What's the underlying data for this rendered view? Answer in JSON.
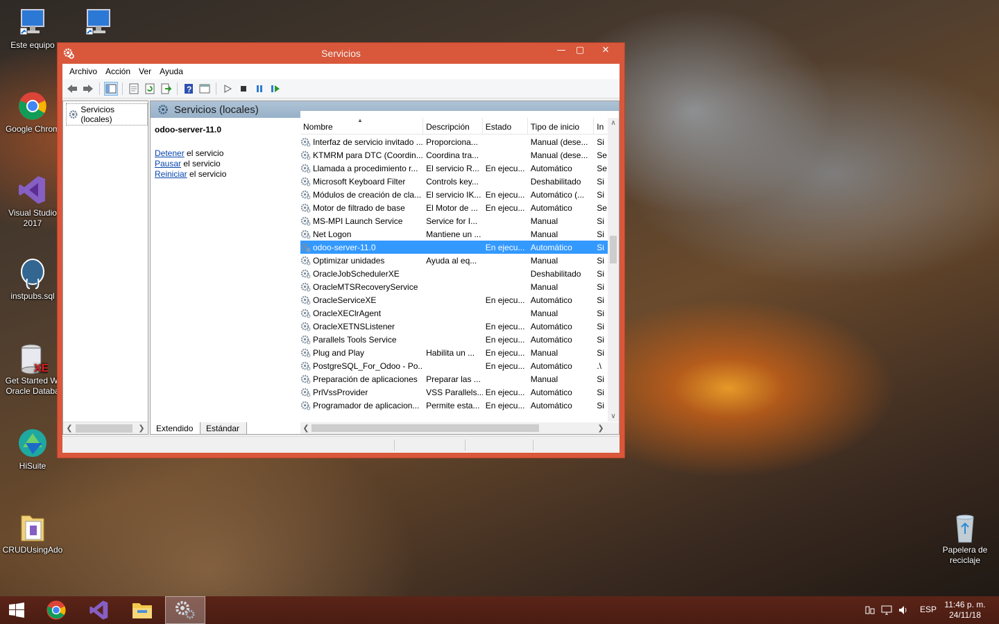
{
  "desktop": {
    "icons": [
      {
        "label": "Este equipo",
        "icon": "computer-icon"
      },
      {
        "label": "",
        "icon": "computer-icon"
      },
      {
        "label": "Google Chrom",
        "icon": "chrome-icon"
      },
      {
        "label": "Visual Studio",
        "label2": "2017",
        "icon": "visual-studio-icon"
      },
      {
        "label": "instpubs.sql",
        "icon": "postgresql-icon"
      },
      {
        "label": "Get Started Wi",
        "label2": "Oracle Databa",
        "icon": "oracle-db-icon"
      },
      {
        "label": "HiSuite",
        "icon": "hisuite-icon"
      },
      {
        "label": "CRUDUsingAdo",
        "icon": "folder-icon"
      },
      {
        "label": "Papelera de",
        "label2": "reciclaje",
        "icon": "recycle-bin-icon"
      }
    ]
  },
  "window": {
    "title": "Servicios",
    "controls": {
      "minimize": "—",
      "maximize": "▢",
      "close": "✕"
    },
    "menu": [
      "Archivo",
      "Acción",
      "Ver",
      "Ayuda"
    ],
    "tree": {
      "item": "Servicios (locales)"
    },
    "header_title": "Servicios (locales)",
    "detail": {
      "service_name": "odoo-server-11.0",
      "actions": [
        {
          "link": "Detener",
          "rest": " el servicio"
        },
        {
          "link": "Pausar",
          "rest": " el servicio"
        },
        {
          "link": "Reiniciar",
          "rest": " el servicio"
        }
      ]
    },
    "columns": [
      "Nombre",
      "Descripción",
      "Estado",
      "Tipo de inicio",
      "In"
    ],
    "rows": [
      [
        "Interfaz de servicio invitado ...",
        "Proporciona...",
        "",
        "Manual (dese...",
        "Si"
      ],
      [
        "KTMRM para DTC (Coordin...",
        "Coordina tra...",
        "",
        "Manual (dese...",
        "Se"
      ],
      [
        "Llamada a procedimiento r...",
        "El servicio R...",
        "En ejecu...",
        "Automático",
        "Se"
      ],
      [
        "Microsoft Keyboard Filter",
        "Controls key...",
        "",
        "Deshabilitado",
        "Si"
      ],
      [
        "Módulos de creación de cla...",
        "El servicio IK...",
        "En ejecu...",
        "Automático (...",
        "Si"
      ],
      [
        "Motor de filtrado de base",
        "El Motor de ...",
        "En ejecu...",
        "Automático",
        "Se"
      ],
      [
        "MS-MPI Launch Service",
        "Service for I...",
        "",
        "Manual",
        "Si"
      ],
      [
        "Net Logon",
        "Mantiene un ...",
        "",
        "Manual",
        "Si"
      ],
      [
        "odoo-server-11.0",
        "",
        "En ejecu...",
        "Automático",
        "Si"
      ],
      [
        "Optimizar unidades",
        "Ayuda al eq...",
        "",
        "Manual",
        "Si"
      ],
      [
        "OracleJobSchedulerXE",
        "",
        "",
        "Deshabilitado",
        "Si"
      ],
      [
        "OracleMTSRecoveryService",
        "",
        "",
        "Manual",
        "Si"
      ],
      [
        "OracleServiceXE",
        "",
        "En ejecu...",
        "Automático",
        "Si"
      ],
      [
        "OracleXEClrAgent",
        "",
        "",
        "Manual",
        "Si"
      ],
      [
        "OracleXETNSListener",
        "",
        "En ejecu...",
        "Automático",
        "Si"
      ],
      [
        "Parallels Tools Service",
        "",
        "En ejecu...",
        "Automático",
        "Si"
      ],
      [
        "Plug and Play",
        "Habilita un ...",
        "En ejecu...",
        "Manual",
        "Si"
      ],
      [
        "PostgreSQL_For_Odoo - Po...",
        "",
        "En ejecu...",
        "Automático",
        ".\\"
      ],
      [
        "Preparación de aplicaciones",
        "Preparar las ...",
        "",
        "Manual",
        "Si"
      ],
      [
        "PrlVssProvider",
        "VSS Parallels...",
        "En ejecu...",
        "Automático",
        "Si"
      ],
      [
        "Programador de aplicacion...",
        "Permite esta...",
        "En ejecu...",
        "Automático",
        "Si"
      ]
    ],
    "selected_row": 8,
    "tabs": [
      "Extendido",
      "Estándar"
    ],
    "active_tab": 0
  },
  "taskbar": {
    "apps": [
      "start-icon",
      "chrome-icon",
      "visual-studio-icon",
      "file-explorer-icon",
      "services-icon"
    ],
    "active_app": 4,
    "language": "ESP",
    "time": "11:46 p. m.",
    "date": "24/11/18"
  },
  "colors": {
    "window_frame": "#d9573a",
    "selection": "#3399ff",
    "header_band": "#aec3d6",
    "taskbar": "#4a1c12",
    "link": "#0645ad"
  }
}
